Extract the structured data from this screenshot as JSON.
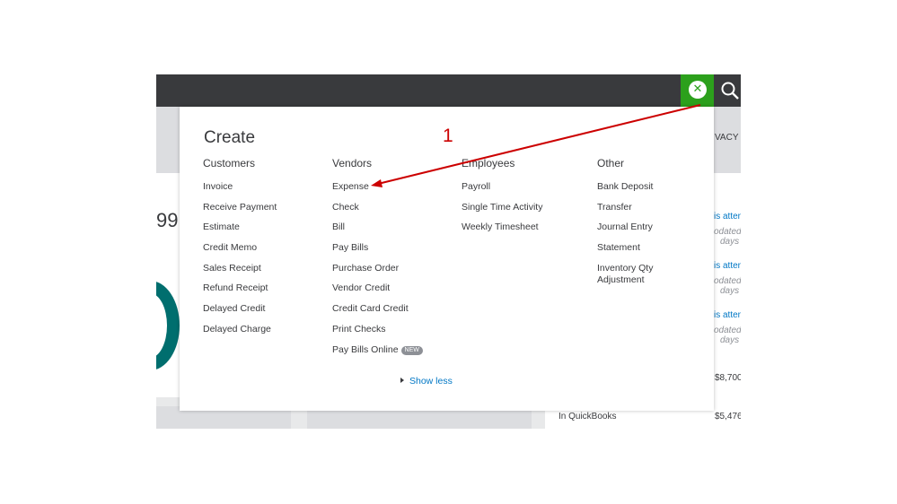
{
  "background": {
    "partial_header": "VACY",
    "partial_number": "99",
    "status_link": "is atten",
    "updated_text": "odated",
    "days_text": "days",
    "amount_1": "$8,700",
    "amount_2": "$5,476",
    "in_quickbooks": "In QuickBooks"
  },
  "create_menu": {
    "title": "Create",
    "columns": [
      {
        "heading": "Customers",
        "items": [
          "Invoice",
          "Receive Payment",
          "Estimate",
          "Credit Memo",
          "Sales Receipt",
          "Refund Receipt",
          "Delayed Credit",
          "Delayed Charge"
        ]
      },
      {
        "heading": "Vendors",
        "items": [
          "Expense",
          "Check",
          "Bill",
          "Pay Bills",
          "Purchase Order",
          "Vendor Credit",
          "Credit Card Credit",
          "Print Checks",
          "Pay Bills Online"
        ],
        "badge": "NEW"
      },
      {
        "heading": "Employees",
        "items": [
          "Payroll",
          "Single Time Activity",
          "Weekly Timesheet"
        ]
      },
      {
        "heading": "Other",
        "items": [
          "Bank Deposit",
          "Transfer",
          "Journal Entry",
          "Statement"
        ],
        "multiline_item": [
          "Inventory Qty",
          "Adjustment"
        ]
      }
    ],
    "show_less": "Show less"
  },
  "annotation": {
    "label": "1",
    "color": "#cc0000"
  },
  "icons": {
    "close": "close-icon",
    "search": "search-icon"
  },
  "colors": {
    "accent": "#2ca01c",
    "topbar": "#393a3d",
    "link": "#0077c5"
  }
}
